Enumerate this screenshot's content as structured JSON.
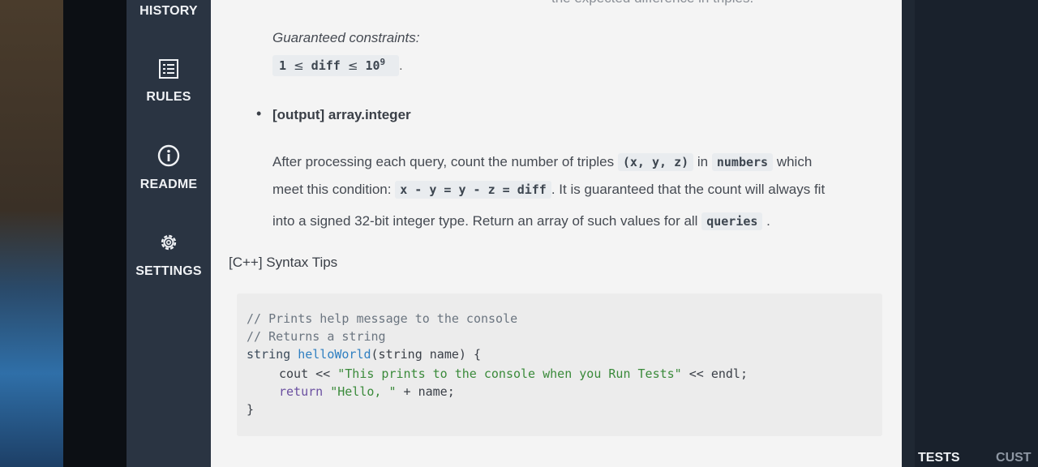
{
  "sidebar": {
    "items": [
      {
        "label": "HISTORY",
        "icon": "history-icon"
      },
      {
        "label": "RULES",
        "icon": "rules-list-icon"
      },
      {
        "label": "README",
        "icon": "info-icon"
      },
      {
        "label": "SETTINGS",
        "icon": "gear-icon"
      }
    ]
  },
  "main": {
    "top_cut_text": "the expected difference in triples.",
    "constraints_heading": "Guaranteed constraints:",
    "constraint": {
      "lhs": "1",
      "le1": "≤",
      "var": "diff",
      "le2": "≤",
      "base": "10",
      "exp": "9",
      "trail": "."
    },
    "output_bullet": "•",
    "output_heading": "[output] array.integer",
    "desc": {
      "line1_a": "After processing each query, count the number of triples",
      "line1_code": "(x, y, z)",
      "line1_b": "in",
      "line1_code2": "numbers",
      "line1_c": "which",
      "line2_a": "meet this condition:",
      "line2_code": "x - y = y - z = diff",
      "line2_b": ". It is guaranteed that the count will always fit",
      "line3_a": "into a signed 32-bit integer type. Return an array of such values for all",
      "line3_code": "queries",
      "line3_b": "."
    },
    "syntax_title": "[C++] Syntax Tips",
    "code": {
      "l1": "// Prints help message to the console",
      "l2": "// Returns a string",
      "l3_type": "string ",
      "l3_fn": "helloWorld",
      "l3_rest": "(string name) {",
      "l4_a": "cout << ",
      "l4_str": "\"This prints to the console when you Run Tests\"",
      "l4_b": " << endl;",
      "l5_kw": "return ",
      "l5_str": "\"Hello, \"",
      "l5_b": " + name;",
      "l6": "}"
    }
  },
  "bottom_tabs": {
    "tests": "TESTS",
    "custom": "CUST"
  },
  "colors": {
    "sidebar": "#2a3442",
    "panel": "#f4f4f4",
    "code_bg": "#ececec",
    "fn_blue": "#2f7fc1"
  }
}
